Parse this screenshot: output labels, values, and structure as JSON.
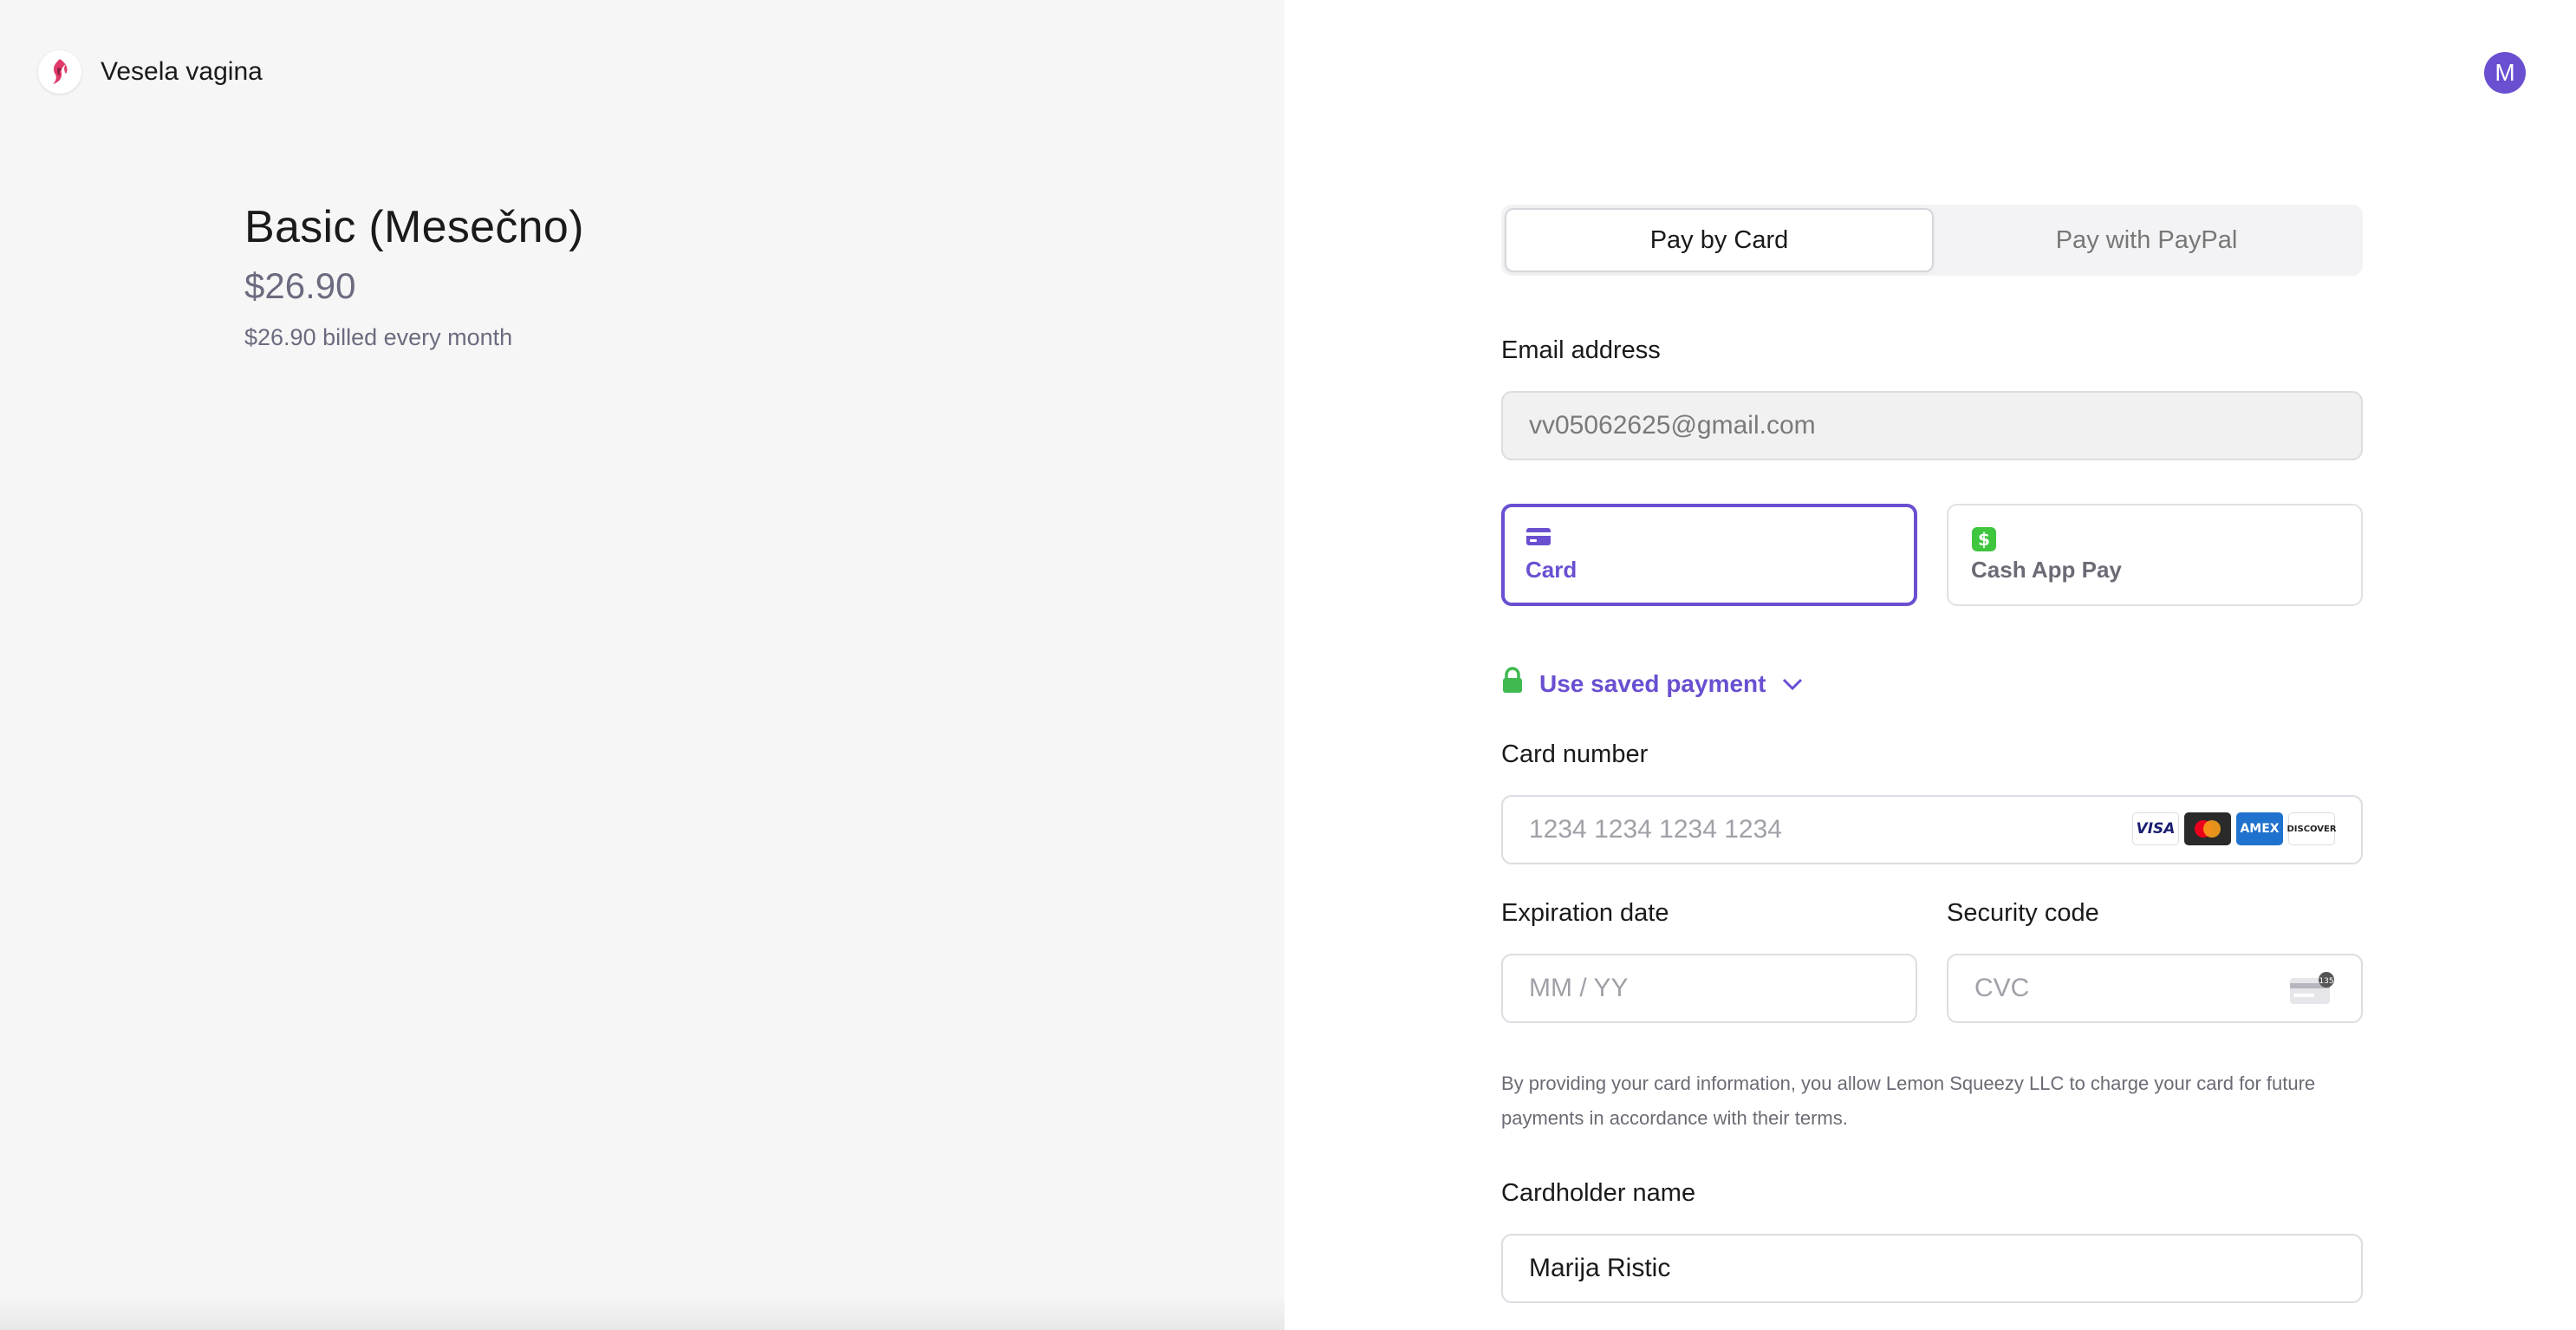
{
  "brand": {
    "name": "Vesela vagina",
    "logo_icon": "brand-logo-icon"
  },
  "product": {
    "title": "Basic (Mesečno)",
    "price": "$26.90",
    "billing": "$26.90 billed every month"
  },
  "user": {
    "avatar_letter": "M"
  },
  "pay_toggle": {
    "card_label": "Pay by Card",
    "paypal_label": "Pay with PayPal",
    "selected": "Pay by Card"
  },
  "email": {
    "label": "Email address",
    "value": "vv05062625@gmail.com"
  },
  "methods": {
    "card": {
      "label": "Card",
      "icon": "credit-card-icon"
    },
    "cashapp": {
      "label": "Cash App Pay",
      "icon": "cash-app-icon"
    },
    "selected": "Card"
  },
  "saved_payment": {
    "label": "Use saved payment",
    "icon": "lock-icon"
  },
  "card_number": {
    "label": "Card number",
    "placeholder": "1234 1234 1234 1234",
    "brands": [
      "VISA",
      "Mastercard",
      "AMEX",
      "DISCOVER"
    ]
  },
  "expiration": {
    "label": "Expiration date",
    "placeholder": "MM / YY"
  },
  "security": {
    "label": "Security code",
    "placeholder": "CVC",
    "hint_number": "135"
  },
  "disclaimer": "By providing your card information, you allow Lemon Squeezy LLC to charge your card for future payments in accordance with their terms.",
  "cardholder": {
    "label": "Cardholder name",
    "value": "Marija Ristic"
  },
  "colors": {
    "accent": "#6a4fd1",
    "lock_green": "#3fb950",
    "cashapp_green": "#3ec63e"
  }
}
